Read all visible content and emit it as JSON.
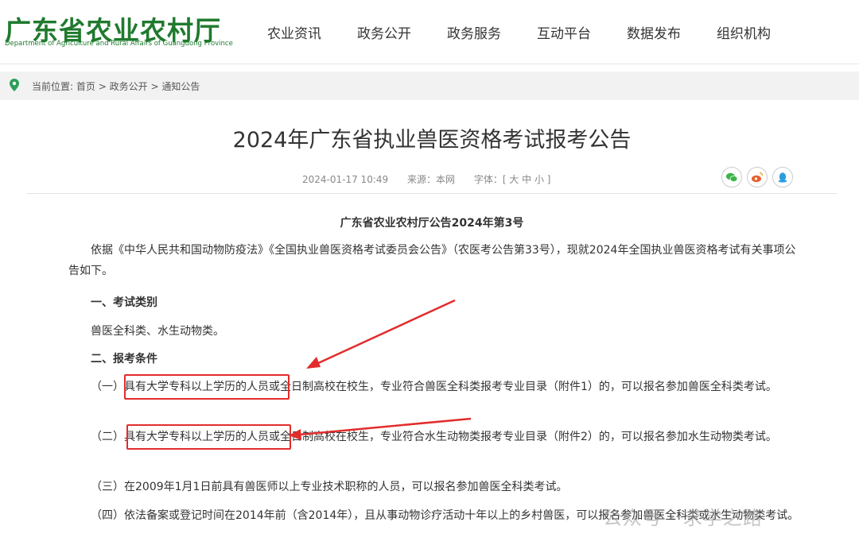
{
  "header": {
    "logo_cn": "广东省农业农村厅",
    "logo_en": "Department of Agriculture and Rural Affairs of Guangdong Province",
    "nav": [
      "农业资讯",
      "政务公开",
      "政务服务",
      "互动平台",
      "数据发布",
      "组织机构"
    ]
  },
  "breadcrumb": {
    "prefix": "当前位置:",
    "items": [
      "首页",
      "政务公开",
      "通知公告"
    ],
    "sep": ">"
  },
  "article": {
    "title": "2024年广东省执业兽医资格考试报考公告",
    "date": "2024-01-17 10:49",
    "source": "来源：本网",
    "font_size_label": "字体：[ 大  中  小 ]",
    "notice_no": "广东省农业农村厅公告2024年第3号",
    "intro": "依据《中华人民共和国动物防疫法》《全国执业兽医资格考试委员会公告》（农医考公告第33号），现就2024年全国执业兽医资格考试有关事项公告如下。",
    "sec1_title": "一、考试类别",
    "sec1_body": "兽医全科类、水生动物类。",
    "sec2_title": "二、报考条件",
    "cond1": "（一）具有大学专科以上学历的人员或全日制高校在校生，专业符合兽医全科类报考专业目录（附件1）的，可以报名参加兽医全科类考试。",
    "cond2": "（二）具有大学专科以上学历的人员或全日制高校在校生，专业符合水生动物类报考专业目录（附件2）的，可以报名参加水生动物类考试。",
    "cond3": "（三）在2009年1月1日前具有兽医师以上专业技术职称的人员，可以报名参加兽医全科类考试。",
    "cond4": "（四）依法备案或登记时间在2014年前（含2014年），且从事动物诊疗活动十年以上的乡村兽医，可以报名参加兽医全科类或水生动物类考试。"
  },
  "share_icons": [
    "wechat-icon",
    "weibo-icon",
    "qq-icon"
  ],
  "watermark": "公众号 · 求学之路",
  "colors": {
    "brand_green": "#1f7a2e",
    "highlight_red": "#e22c2c"
  }
}
